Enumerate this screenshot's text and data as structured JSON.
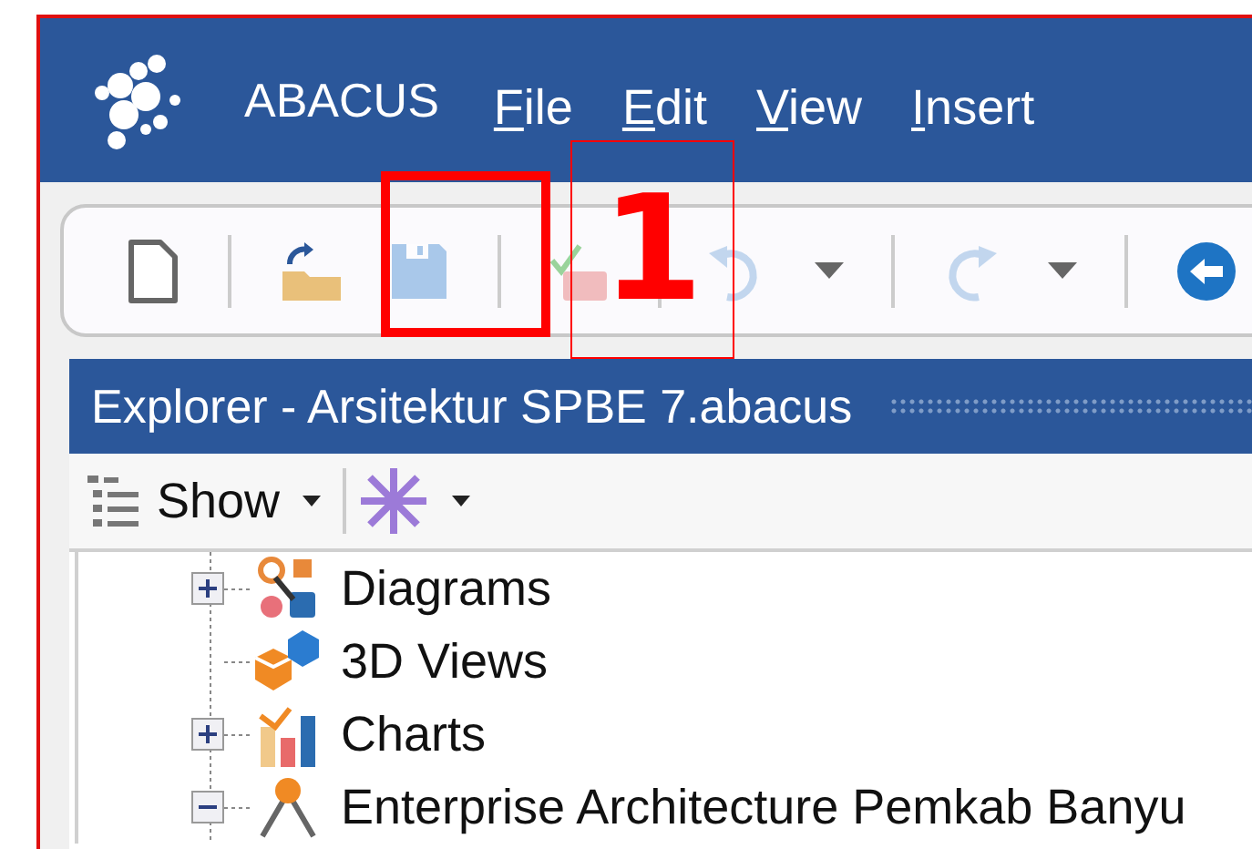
{
  "app": {
    "name": "ABACUS"
  },
  "menu": [
    {
      "label": "File"
    },
    {
      "label": "Edit"
    },
    {
      "label": "View"
    },
    {
      "label": "Insert"
    }
  ],
  "toolbar": [
    {
      "kind": "button",
      "disabled": false,
      "dropdown": false
    },
    {
      "kind": "separator"
    },
    {
      "kind": "button",
      "disabled": false,
      "dropdown": false
    },
    {
      "kind": "button",
      "disabled": true,
      "dropdown": false
    },
    {
      "kind": "separator"
    },
    {
      "kind": "button",
      "disabled": true,
      "dropdown": false
    },
    {
      "kind": "separator"
    },
    {
      "kind": "button",
      "disabled": true,
      "dropdown": true
    },
    {
      "kind": "separator"
    },
    {
      "kind": "button",
      "disabled": true,
      "dropdown": true
    },
    {
      "kind": "separator"
    },
    {
      "kind": "button",
      "disabled": false,
      "dropdown": false
    }
  ],
  "explorer": {
    "title": "Explorer - Arsitektur SPBE 7.abacus",
    "show_button": {
      "label": "Show"
    },
    "tree": [
      {
        "label": "Diagrams",
        "kind": "branch",
        "expanded": false
      },
      {
        "label": "3D Views",
        "kind": "leaf"
      },
      {
        "label": "Charts",
        "kind": "branch",
        "expanded": false
      },
      {
        "label": "Enterprise Architecture Pemkab Banyu",
        "kind": "branch",
        "expanded": true
      }
    ]
  },
  "annotations": [
    {
      "kind": "box"
    },
    {
      "kind": "callout",
      "label": "1"
    }
  ]
}
